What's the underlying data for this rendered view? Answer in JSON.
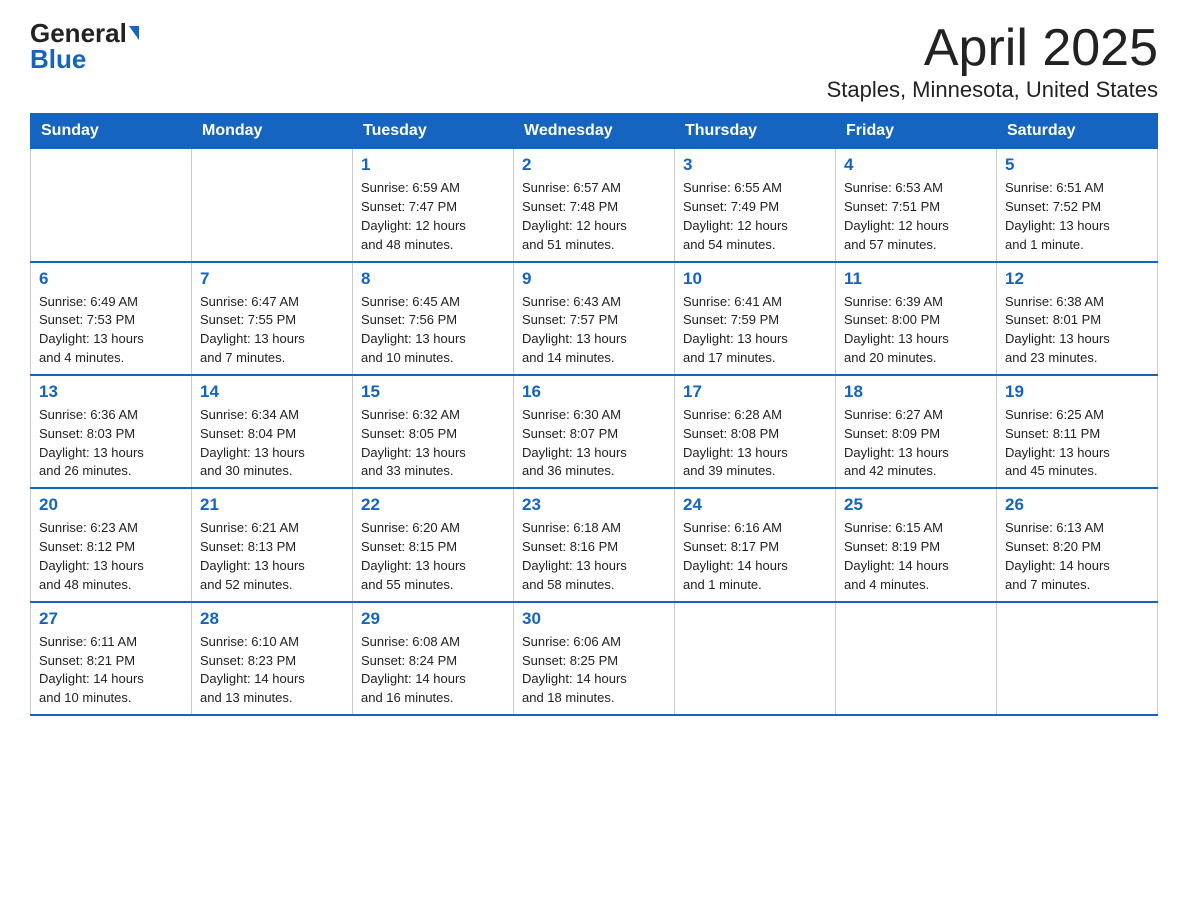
{
  "logo": {
    "general": "General",
    "blue": "Blue",
    "triangle": "▶"
  },
  "title": "April 2025",
  "subtitle": "Staples, Minnesota, United States",
  "headers": [
    "Sunday",
    "Monday",
    "Tuesday",
    "Wednesday",
    "Thursday",
    "Friday",
    "Saturday"
  ],
  "weeks": [
    [
      {
        "day": "",
        "info": ""
      },
      {
        "day": "",
        "info": ""
      },
      {
        "day": "1",
        "info": "Sunrise: 6:59 AM\nSunset: 7:47 PM\nDaylight: 12 hours\nand 48 minutes."
      },
      {
        "day": "2",
        "info": "Sunrise: 6:57 AM\nSunset: 7:48 PM\nDaylight: 12 hours\nand 51 minutes."
      },
      {
        "day": "3",
        "info": "Sunrise: 6:55 AM\nSunset: 7:49 PM\nDaylight: 12 hours\nand 54 minutes."
      },
      {
        "day": "4",
        "info": "Sunrise: 6:53 AM\nSunset: 7:51 PM\nDaylight: 12 hours\nand 57 minutes."
      },
      {
        "day": "5",
        "info": "Sunrise: 6:51 AM\nSunset: 7:52 PM\nDaylight: 13 hours\nand 1 minute."
      }
    ],
    [
      {
        "day": "6",
        "info": "Sunrise: 6:49 AM\nSunset: 7:53 PM\nDaylight: 13 hours\nand 4 minutes."
      },
      {
        "day": "7",
        "info": "Sunrise: 6:47 AM\nSunset: 7:55 PM\nDaylight: 13 hours\nand 7 minutes."
      },
      {
        "day": "8",
        "info": "Sunrise: 6:45 AM\nSunset: 7:56 PM\nDaylight: 13 hours\nand 10 minutes."
      },
      {
        "day": "9",
        "info": "Sunrise: 6:43 AM\nSunset: 7:57 PM\nDaylight: 13 hours\nand 14 minutes."
      },
      {
        "day": "10",
        "info": "Sunrise: 6:41 AM\nSunset: 7:59 PM\nDaylight: 13 hours\nand 17 minutes."
      },
      {
        "day": "11",
        "info": "Sunrise: 6:39 AM\nSunset: 8:00 PM\nDaylight: 13 hours\nand 20 minutes."
      },
      {
        "day": "12",
        "info": "Sunrise: 6:38 AM\nSunset: 8:01 PM\nDaylight: 13 hours\nand 23 minutes."
      }
    ],
    [
      {
        "day": "13",
        "info": "Sunrise: 6:36 AM\nSunset: 8:03 PM\nDaylight: 13 hours\nand 26 minutes."
      },
      {
        "day": "14",
        "info": "Sunrise: 6:34 AM\nSunset: 8:04 PM\nDaylight: 13 hours\nand 30 minutes."
      },
      {
        "day": "15",
        "info": "Sunrise: 6:32 AM\nSunset: 8:05 PM\nDaylight: 13 hours\nand 33 minutes."
      },
      {
        "day": "16",
        "info": "Sunrise: 6:30 AM\nSunset: 8:07 PM\nDaylight: 13 hours\nand 36 minutes."
      },
      {
        "day": "17",
        "info": "Sunrise: 6:28 AM\nSunset: 8:08 PM\nDaylight: 13 hours\nand 39 minutes."
      },
      {
        "day": "18",
        "info": "Sunrise: 6:27 AM\nSunset: 8:09 PM\nDaylight: 13 hours\nand 42 minutes."
      },
      {
        "day": "19",
        "info": "Sunrise: 6:25 AM\nSunset: 8:11 PM\nDaylight: 13 hours\nand 45 minutes."
      }
    ],
    [
      {
        "day": "20",
        "info": "Sunrise: 6:23 AM\nSunset: 8:12 PM\nDaylight: 13 hours\nand 48 minutes."
      },
      {
        "day": "21",
        "info": "Sunrise: 6:21 AM\nSunset: 8:13 PM\nDaylight: 13 hours\nand 52 minutes."
      },
      {
        "day": "22",
        "info": "Sunrise: 6:20 AM\nSunset: 8:15 PM\nDaylight: 13 hours\nand 55 minutes."
      },
      {
        "day": "23",
        "info": "Sunrise: 6:18 AM\nSunset: 8:16 PM\nDaylight: 13 hours\nand 58 minutes."
      },
      {
        "day": "24",
        "info": "Sunrise: 6:16 AM\nSunset: 8:17 PM\nDaylight: 14 hours\nand 1 minute."
      },
      {
        "day": "25",
        "info": "Sunrise: 6:15 AM\nSunset: 8:19 PM\nDaylight: 14 hours\nand 4 minutes."
      },
      {
        "day": "26",
        "info": "Sunrise: 6:13 AM\nSunset: 8:20 PM\nDaylight: 14 hours\nand 7 minutes."
      }
    ],
    [
      {
        "day": "27",
        "info": "Sunrise: 6:11 AM\nSunset: 8:21 PM\nDaylight: 14 hours\nand 10 minutes."
      },
      {
        "day": "28",
        "info": "Sunrise: 6:10 AM\nSunset: 8:23 PM\nDaylight: 14 hours\nand 13 minutes."
      },
      {
        "day": "29",
        "info": "Sunrise: 6:08 AM\nSunset: 8:24 PM\nDaylight: 14 hours\nand 16 minutes."
      },
      {
        "day": "30",
        "info": "Sunrise: 6:06 AM\nSunset: 8:25 PM\nDaylight: 14 hours\nand 18 minutes."
      },
      {
        "day": "",
        "info": ""
      },
      {
        "day": "",
        "info": ""
      },
      {
        "day": "",
        "info": ""
      }
    ]
  ]
}
